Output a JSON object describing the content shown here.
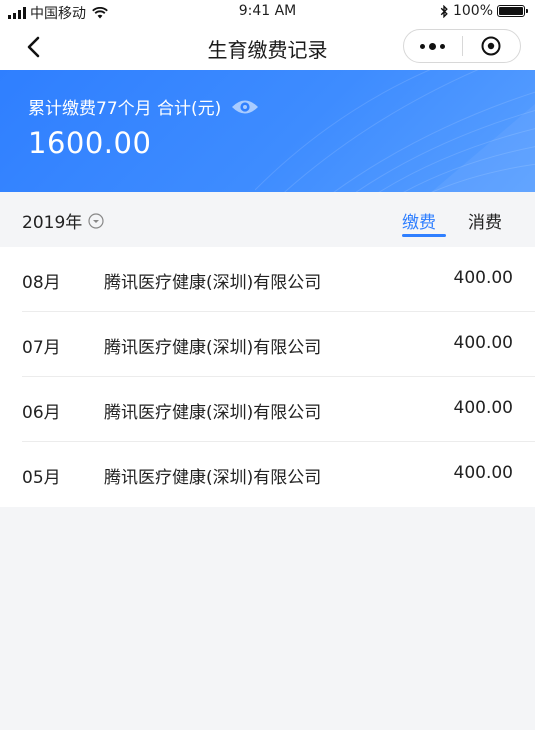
{
  "status_bar": {
    "carrier": "中国移动",
    "time": "9:41 AM",
    "battery": "100%"
  },
  "nav": {
    "title": "生育缴费记录",
    "back_icon": "back-arrow-icon",
    "more_icon": "more-dots-icon",
    "close_icon": "target-circle-icon"
  },
  "summary": {
    "label": "累计缴费77个月 合计(元)",
    "amount": "1600.00",
    "eye_icon": "eye-icon",
    "accent_color": "#2f7fff"
  },
  "filter": {
    "year": "2019年",
    "tabs": [
      {
        "label": "缴费",
        "active": true
      },
      {
        "label": "消费",
        "active": false
      }
    ]
  },
  "records": [
    {
      "month": "08月",
      "company": "腾讯医疗健康(深圳)有限公司",
      "amount": "400.00"
    },
    {
      "month": "07月",
      "company": "腾讯医疗健康(深圳)有限公司",
      "amount": "400.00"
    },
    {
      "month": "06月",
      "company": "腾讯医疗健康(深圳)有限公司",
      "amount": "400.00"
    },
    {
      "month": "05月",
      "company": "腾讯医疗健康(深圳)有限公司",
      "amount": "400.00"
    }
  ]
}
